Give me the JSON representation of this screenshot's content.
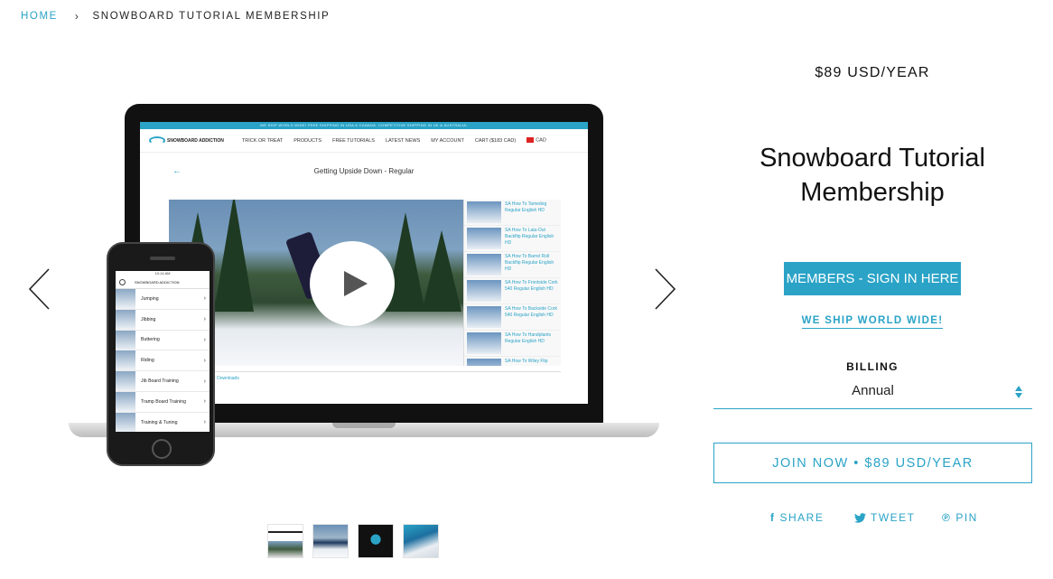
{
  "breadcrumb": {
    "home": "HOME",
    "separator": "›",
    "current": "SNOWBOARD TUTORIAL MEMBERSHIP"
  },
  "product": {
    "price": "$89 USD/YEAR",
    "title_line1": "Snowboard Tutorial",
    "title_line2": "Membership",
    "signin_label": "MEMBERS - SIGN IN HERE",
    "ship_label": "WE SHIP WORLD WIDE!",
    "billing_label": "BILLING",
    "billing_value": "Annual",
    "join_label": "JOIN NOW • $89 USD/YEAR"
  },
  "social": {
    "share": "SHARE",
    "tweet": "TWEET",
    "pin": "PIN"
  },
  "gallery": {
    "prev_icon": "chevron-left-icon",
    "next_icon": "chevron-right-icon",
    "thumbnail_count": 4
  },
  "laptop_screen": {
    "topbar": "WE SHIP WORLD WIDE! FREE SHIPPING IN USA & CANADA. COMPETITIVE SHIPPING IN UK & AUSTRALIA.",
    "logo": "SNOWBOARD ADDICTION",
    "nav": [
      "TRICK OR TREAT",
      "PRODUCTS",
      "FREE TUTORIALS",
      "LATEST NEWS",
      "MY ACCOUNT",
      "CART ($183 CAD)",
      "CAD"
    ],
    "video_title": "Getting Upside Down - Regular",
    "playlist": [
      "SA How To Tamedog Regular English HD",
      "SA How To Lala-Out Backflip Regular English HD",
      "SA How To Barrel Roll Backflip Regular English HD",
      "SA How To Frontside Cork 540 Regular English HD",
      "SA How To Backside Cork 540 Regular English HD",
      "SA How To Handplants Regular English HD",
      "SA How To Wiley Flip"
    ],
    "downloads": "Upside Down - Regular Downloads"
  },
  "phone_screen": {
    "status": "10:14 AM",
    "logo": "SNOWBOARD ADDICTION",
    "items": [
      "Jumping",
      "Jibbing",
      "Buttering",
      "Riding",
      "Jib Board Training",
      "Tramp Board Training",
      "Training & Tuning"
    ]
  },
  "colors": {
    "accent": "#2aa3c7",
    "text": "#111111",
    "background": "#ffffff"
  }
}
